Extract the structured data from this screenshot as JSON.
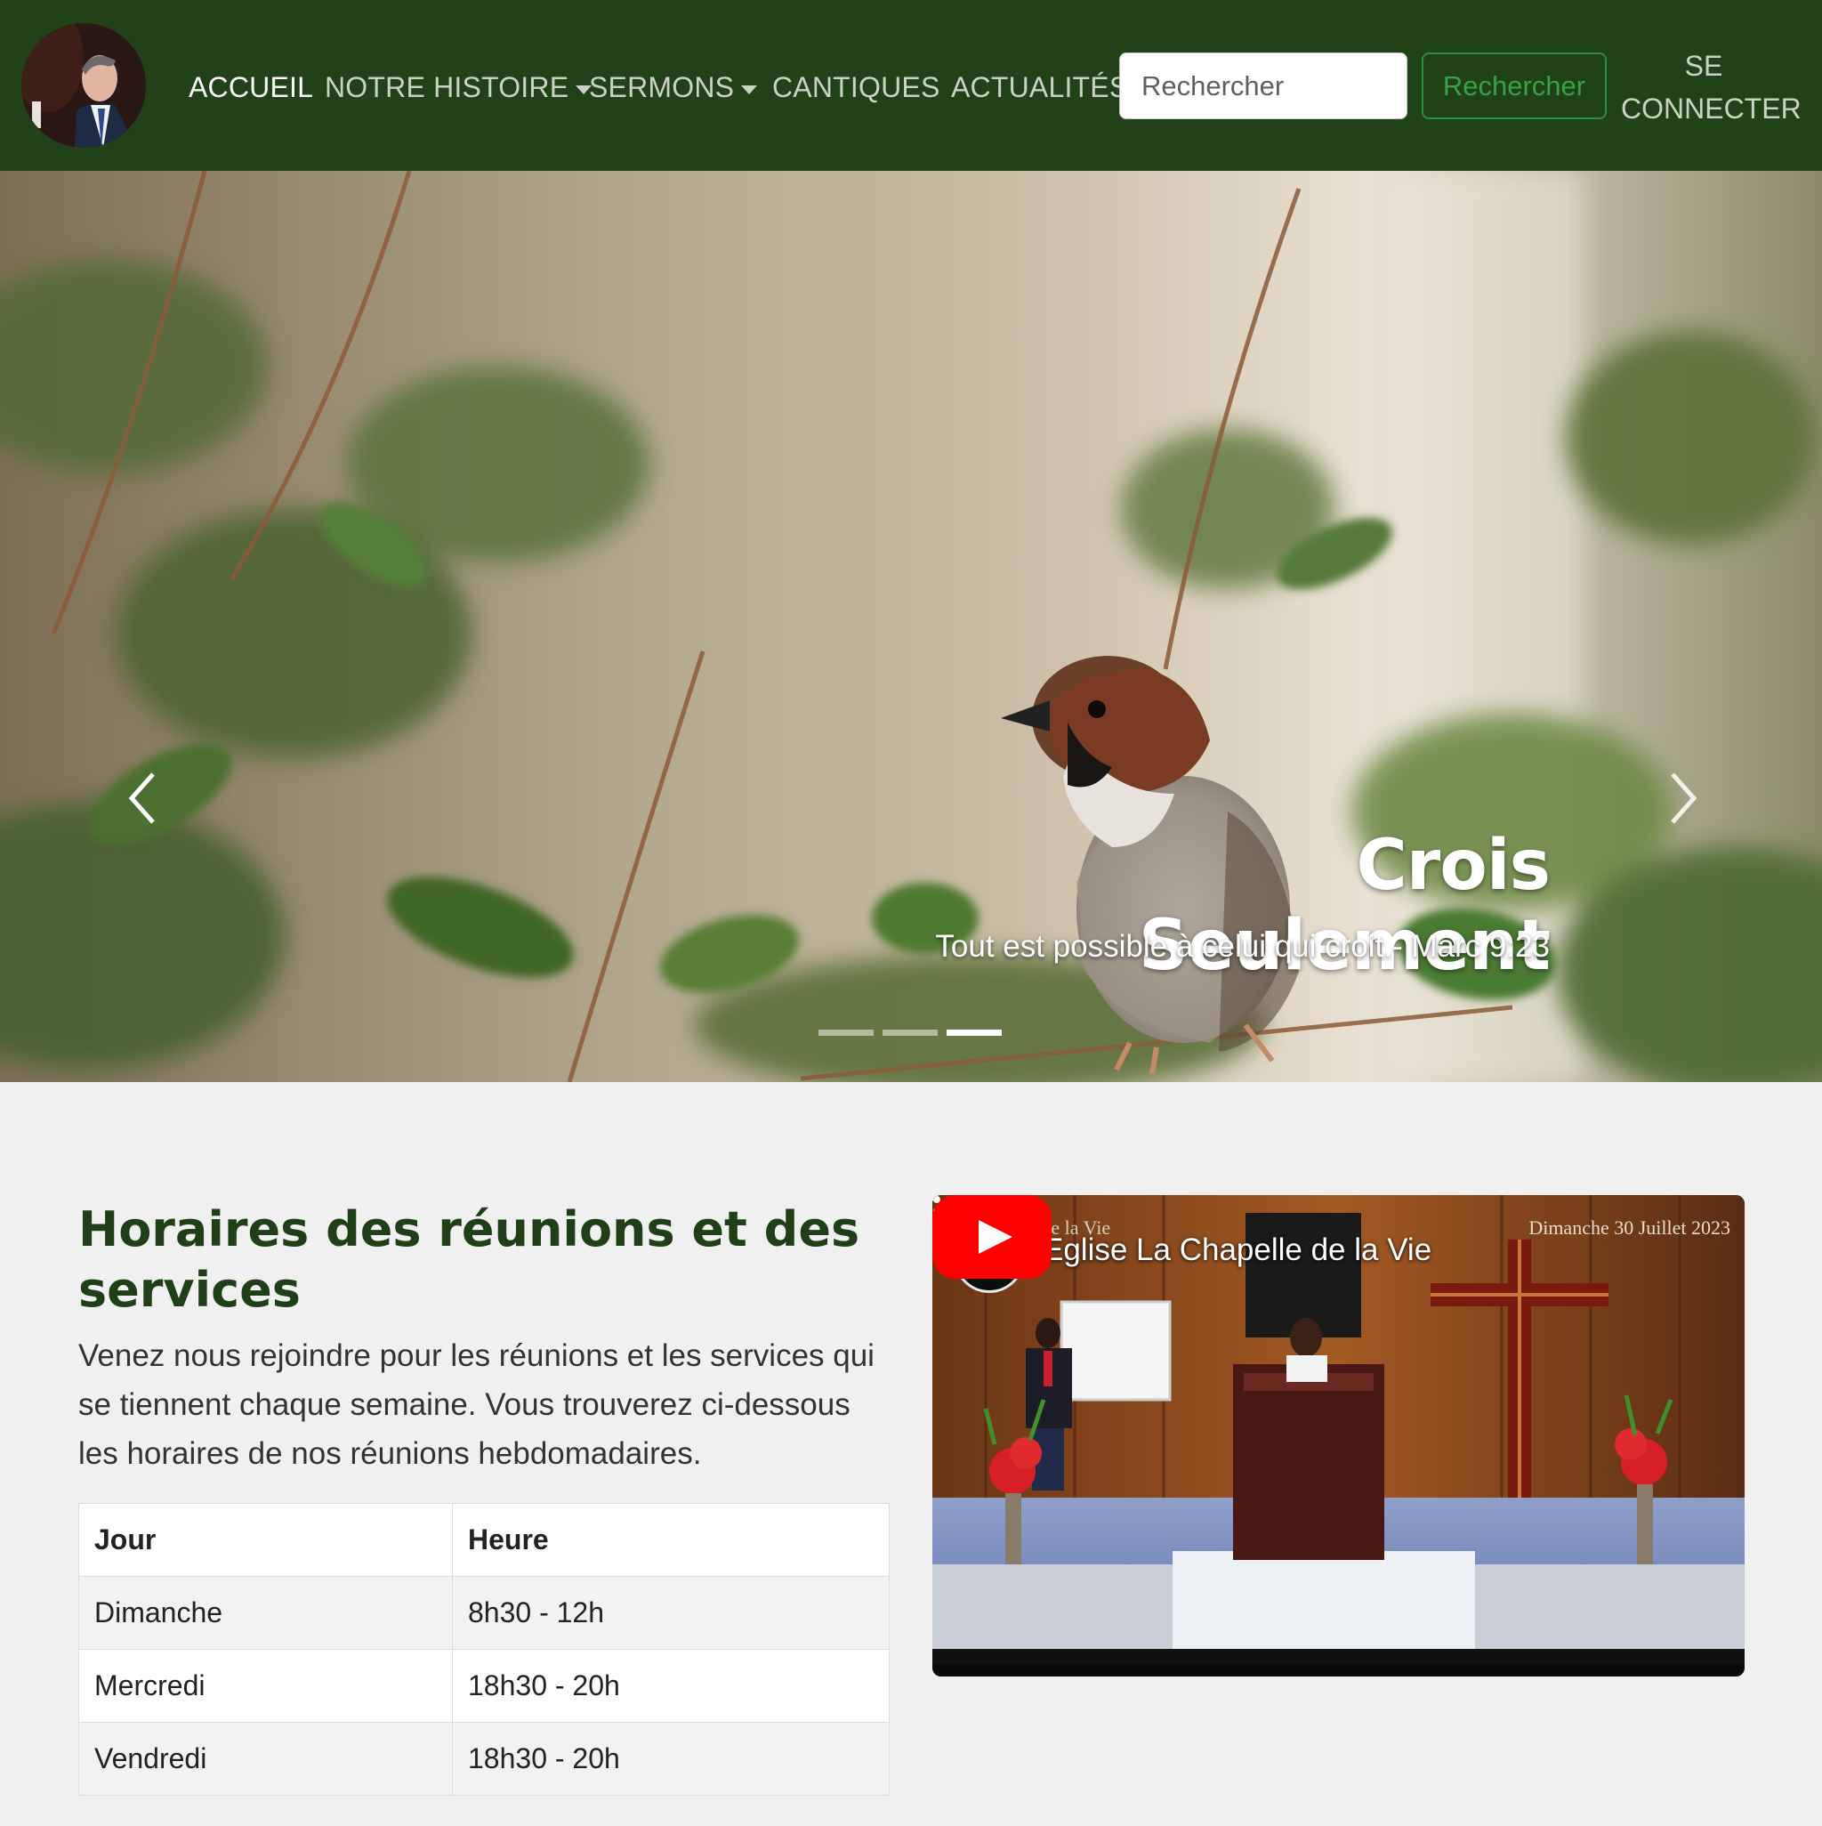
{
  "navbar": {
    "items": [
      {
        "label": "ACCUEIL",
        "active": true
      },
      {
        "label": "NOTRE HISTOIRE",
        "dropdown": true
      },
      {
        "label": "SERMONS",
        "dropdown": true
      },
      {
        "label": "CANTIQUES"
      },
      {
        "label": "ACTUALITÉS"
      }
    ],
    "search_placeholder": "Rechercher",
    "search_button": "Rechercher",
    "login_line1": "SE",
    "login_line2": "CONNECTER"
  },
  "hero": {
    "title": "Crois Seulement",
    "subtitle": "Tout est possible à celui qui croit.- Marc 9:23",
    "slide_count": 3,
    "active_slide": 3
  },
  "services": {
    "title": "Horaires des réunions et des services",
    "description": "Venez nous rejoindre pour les réunions et les services qui se tiennent chaque semaine. Vous trouverez ci-dessous les horaires de nos réunions hebdomadaires.",
    "headers": [
      "Jour",
      "Heure"
    ],
    "rows": [
      [
        "Dimanche",
        "8h30 - 12h"
      ],
      [
        "Mercredi",
        "18h30 - 20h"
      ],
      [
        "Vendredi",
        "18h30 - 20h"
      ]
    ]
  },
  "video": {
    "title": "Eglise La Chapelle de la Vie",
    "overlay_channel": "La Chapelle de la Vie",
    "overlay_date": "Dimanche 30 Juillet 2023"
  },
  "colors": {
    "navbar_bg": "#214119",
    "heading": "#1f4017",
    "search_button": "#3aa04a",
    "youtube_red": "#ff0000"
  }
}
